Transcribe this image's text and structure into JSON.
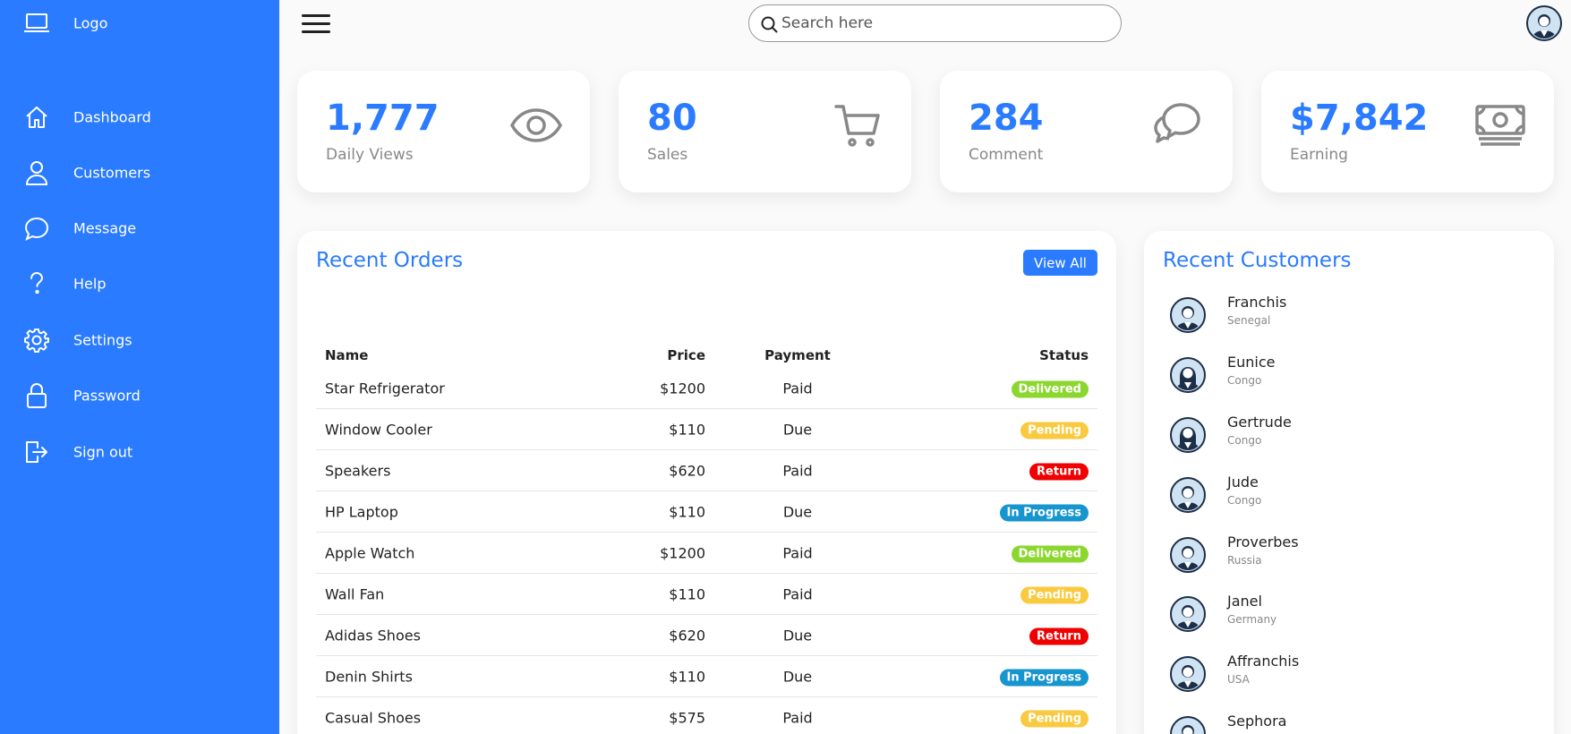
{
  "sidebar": {
    "logo": {
      "label": "Logo",
      "icon": "laptop-icon"
    },
    "items": [
      {
        "label": "Dashboard",
        "icon": "home-icon"
      },
      {
        "label": "Customers",
        "icon": "person-icon"
      },
      {
        "label": "Message",
        "icon": "chat-icon"
      },
      {
        "label": "Help",
        "icon": "question-icon"
      },
      {
        "label": "Settings",
        "icon": "gear-icon"
      },
      {
        "label": "Password",
        "icon": "lock-icon"
      },
      {
        "label": "Sign out",
        "icon": "sign-out-icon"
      }
    ]
  },
  "search": {
    "placeholder": "Search here"
  },
  "cards": [
    {
      "value": "1,777",
      "label": "Daily Views",
      "icon": "eye-icon"
    },
    {
      "value": "80",
      "label": "Sales",
      "icon": "cart-icon"
    },
    {
      "value": "284",
      "label": "Comment",
      "icon": "chat-bubbles-icon"
    },
    {
      "value": "$7,842",
      "label": "Earning",
      "icon": "money-icon"
    }
  ],
  "orders": {
    "title": "Recent Orders",
    "view_all": "View All",
    "headers": {
      "name": "Name",
      "price": "Price",
      "payment": "Payment",
      "status": "Status"
    },
    "rows": [
      {
        "name": "Star Refrigerator",
        "price": "$1200",
        "payment": "Paid",
        "status": "Delivered"
      },
      {
        "name": "Window Cooler",
        "price": "$110",
        "payment": "Due",
        "status": "Pending"
      },
      {
        "name": "Speakers",
        "price": "$620",
        "payment": "Paid",
        "status": "Return"
      },
      {
        "name": "HP Laptop",
        "price": "$110",
        "payment": "Due",
        "status": "In Progress"
      },
      {
        "name": "Apple Watch",
        "price": "$1200",
        "payment": "Paid",
        "status": "Delivered"
      },
      {
        "name": "Wall Fan",
        "price": "$110",
        "payment": "Paid",
        "status": "Pending"
      },
      {
        "name": "Adidas Shoes",
        "price": "$620",
        "payment": "Due",
        "status": "Return"
      },
      {
        "name": "Denin Shirts",
        "price": "$110",
        "payment": "Due",
        "status": "In Progress"
      },
      {
        "name": "Casual Shoes",
        "price": "$575",
        "payment": "Paid",
        "status": "Pending"
      }
    ],
    "status_colors": {
      "Delivered": "#8cd630",
      "Pending": "#f9ca3f",
      "Return": "#f00000",
      "In Progress": "#1795ce"
    }
  },
  "customers": {
    "title": "Recent Customers",
    "list": [
      {
        "name": "Franchis",
        "country": "Senegal",
        "gender": "male"
      },
      {
        "name": "Eunice",
        "country": "Congo",
        "gender": "female"
      },
      {
        "name": "Gertrude",
        "country": "Congo",
        "gender": "female"
      },
      {
        "name": "Jude",
        "country": "Congo",
        "gender": "male"
      },
      {
        "name": "Proverbes",
        "country": "Russia",
        "gender": "male"
      },
      {
        "name": "Janel",
        "country": "Germany",
        "gender": "male"
      },
      {
        "name": "Affranchis",
        "country": "USA",
        "gender": "male"
      },
      {
        "name": "Sephora",
        "country": "",
        "gender": "male"
      }
    ]
  },
  "colors": {
    "accent": "#2a7bff"
  }
}
